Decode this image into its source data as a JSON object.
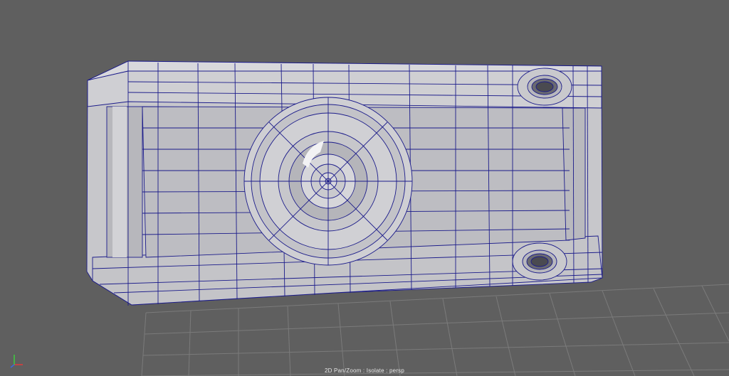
{
  "viewport": {
    "hud_label": "2D Pan/Zoom : Isolate : persp",
    "background_color": "#5f5f5f",
    "grid_color": "#7a7a7a",
    "mesh_fill_color": "#c9c9cc",
    "wire_color": "#1b1b8a"
  },
  "axis_gizmo": {
    "x_color": "#e03a3a",
    "y_color": "#3fcf3f",
    "z_color": "#3a6be0"
  }
}
